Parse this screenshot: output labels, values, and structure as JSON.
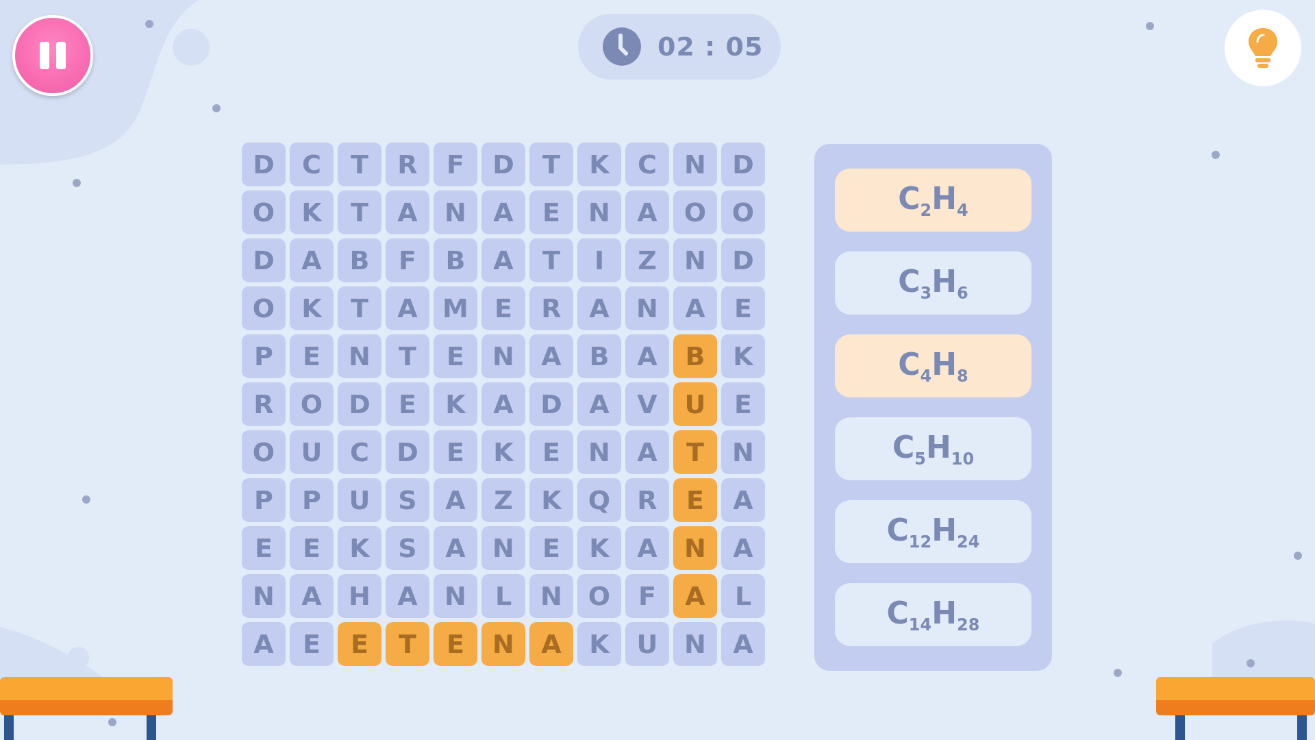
{
  "timer": {
    "text": "02 : 05"
  },
  "grid": {
    "rows": [
      [
        {
          "letter": "D",
          "found": false
        },
        {
          "letter": "C",
          "found": false
        },
        {
          "letter": "T",
          "found": false
        },
        {
          "letter": "R",
          "found": false
        },
        {
          "letter": "F",
          "found": false
        },
        {
          "letter": "D",
          "found": false
        },
        {
          "letter": "T",
          "found": false
        },
        {
          "letter": "K",
          "found": false
        },
        {
          "letter": "C",
          "found": false
        },
        {
          "letter": "N",
          "found": false
        },
        {
          "letter": "D",
          "found": false
        }
      ],
      [
        {
          "letter": "O",
          "found": false
        },
        {
          "letter": "K",
          "found": false
        },
        {
          "letter": "T",
          "found": false
        },
        {
          "letter": "A",
          "found": false
        },
        {
          "letter": "N",
          "found": false
        },
        {
          "letter": "A",
          "found": false
        },
        {
          "letter": "E",
          "found": false
        },
        {
          "letter": "N",
          "found": false
        },
        {
          "letter": "A",
          "found": false
        },
        {
          "letter": "O",
          "found": false
        },
        {
          "letter": "O",
          "found": false
        }
      ],
      [
        {
          "letter": "D",
          "found": false
        },
        {
          "letter": "A",
          "found": false
        },
        {
          "letter": "B",
          "found": false
        },
        {
          "letter": "F",
          "found": false
        },
        {
          "letter": "B",
          "found": false
        },
        {
          "letter": "A",
          "found": false
        },
        {
          "letter": "T",
          "found": false
        },
        {
          "letter": "I",
          "found": false
        },
        {
          "letter": "Z",
          "found": false
        },
        {
          "letter": "N",
          "found": false
        },
        {
          "letter": "D",
          "found": false
        }
      ],
      [
        {
          "letter": "O",
          "found": false
        },
        {
          "letter": "K",
          "found": false
        },
        {
          "letter": "T",
          "found": false
        },
        {
          "letter": "A",
          "found": false
        },
        {
          "letter": "M",
          "found": false
        },
        {
          "letter": "E",
          "found": false
        },
        {
          "letter": "R",
          "found": false
        },
        {
          "letter": "A",
          "found": false
        },
        {
          "letter": "N",
          "found": false
        },
        {
          "letter": "A",
          "found": false
        },
        {
          "letter": "E",
          "found": false
        }
      ],
      [
        {
          "letter": "P",
          "found": false
        },
        {
          "letter": "E",
          "found": false
        },
        {
          "letter": "N",
          "found": false
        },
        {
          "letter": "T",
          "found": false
        },
        {
          "letter": "E",
          "found": false
        },
        {
          "letter": "N",
          "found": false
        },
        {
          "letter": "A",
          "found": false
        },
        {
          "letter": "B",
          "found": false
        },
        {
          "letter": "A",
          "found": false
        },
        {
          "letter": "B",
          "found": true
        },
        {
          "letter": "K",
          "found": false
        }
      ],
      [
        {
          "letter": "R",
          "found": false
        },
        {
          "letter": "O",
          "found": false
        },
        {
          "letter": "D",
          "found": false
        },
        {
          "letter": "E",
          "found": false
        },
        {
          "letter": "K",
          "found": false
        },
        {
          "letter": "A",
          "found": false
        },
        {
          "letter": "D",
          "found": false
        },
        {
          "letter": "A",
          "found": false
        },
        {
          "letter": "V",
          "found": false
        },
        {
          "letter": "U",
          "found": true
        },
        {
          "letter": "E",
          "found": false
        }
      ],
      [
        {
          "letter": "O",
          "found": false
        },
        {
          "letter": "U",
          "found": false
        },
        {
          "letter": "C",
          "found": false
        },
        {
          "letter": "D",
          "found": false
        },
        {
          "letter": "E",
          "found": false
        },
        {
          "letter": "K",
          "found": false
        },
        {
          "letter": "E",
          "found": false
        },
        {
          "letter": "N",
          "found": false
        },
        {
          "letter": "A",
          "found": false
        },
        {
          "letter": "T",
          "found": true
        },
        {
          "letter": "N",
          "found": false
        }
      ],
      [
        {
          "letter": "P",
          "found": false
        },
        {
          "letter": "P",
          "found": false
        },
        {
          "letter": "U",
          "found": false
        },
        {
          "letter": "S",
          "found": false
        },
        {
          "letter": "A",
          "found": false
        },
        {
          "letter": "Z",
          "found": false
        },
        {
          "letter": "K",
          "found": false
        },
        {
          "letter": "Q",
          "found": false
        },
        {
          "letter": "R",
          "found": false
        },
        {
          "letter": "E",
          "found": true
        },
        {
          "letter": "A",
          "found": false
        }
      ],
      [
        {
          "letter": "E",
          "found": false
        },
        {
          "letter": "E",
          "found": false
        },
        {
          "letter": "K",
          "found": false
        },
        {
          "letter": "S",
          "found": false
        },
        {
          "letter": "A",
          "found": false
        },
        {
          "letter": "N",
          "found": false
        },
        {
          "letter": "E",
          "found": false
        },
        {
          "letter": "K",
          "found": false
        },
        {
          "letter": "A",
          "found": false
        },
        {
          "letter": "N",
          "found": true
        },
        {
          "letter": "A",
          "found": false
        }
      ],
      [
        {
          "letter": "N",
          "found": false
        },
        {
          "letter": "A",
          "found": false
        },
        {
          "letter": "H",
          "found": false
        },
        {
          "letter": "A",
          "found": false
        },
        {
          "letter": "N",
          "found": false
        },
        {
          "letter": "L",
          "found": false
        },
        {
          "letter": "N",
          "found": false
        },
        {
          "letter": "O",
          "found": false
        },
        {
          "letter": "F",
          "found": false
        },
        {
          "letter": "A",
          "found": true
        },
        {
          "letter": "L",
          "found": false
        }
      ],
      [
        {
          "letter": "A",
          "found": false
        },
        {
          "letter": "E",
          "found": false
        },
        {
          "letter": "E",
          "found": true
        },
        {
          "letter": "T",
          "found": true
        },
        {
          "letter": "E",
          "found": true
        },
        {
          "letter": "N",
          "found": true
        },
        {
          "letter": "A",
          "found": true
        },
        {
          "letter": "K",
          "found": false
        },
        {
          "letter": "U",
          "found": false
        },
        {
          "letter": "N",
          "found": false
        },
        {
          "letter": "A",
          "found": false
        }
      ]
    ]
  },
  "words": [
    {
      "text": "C$_{2}$H$_{4}$",
      "found": true
    },
    {
      "text": "C$_{3}$H$_{6}$",
      "found": false
    },
    {
      "text": "C$_{4}$H$_{8}$",
      "found": true
    },
    {
      "text": "C$_{5}$H$_{10}$",
      "found": false
    },
    {
      "text": "C$_{12}$H$_{24}$",
      "found": false
    },
    {
      "text": "C$_{14}$H$_{28}$",
      "found": false
    }
  ]
}
